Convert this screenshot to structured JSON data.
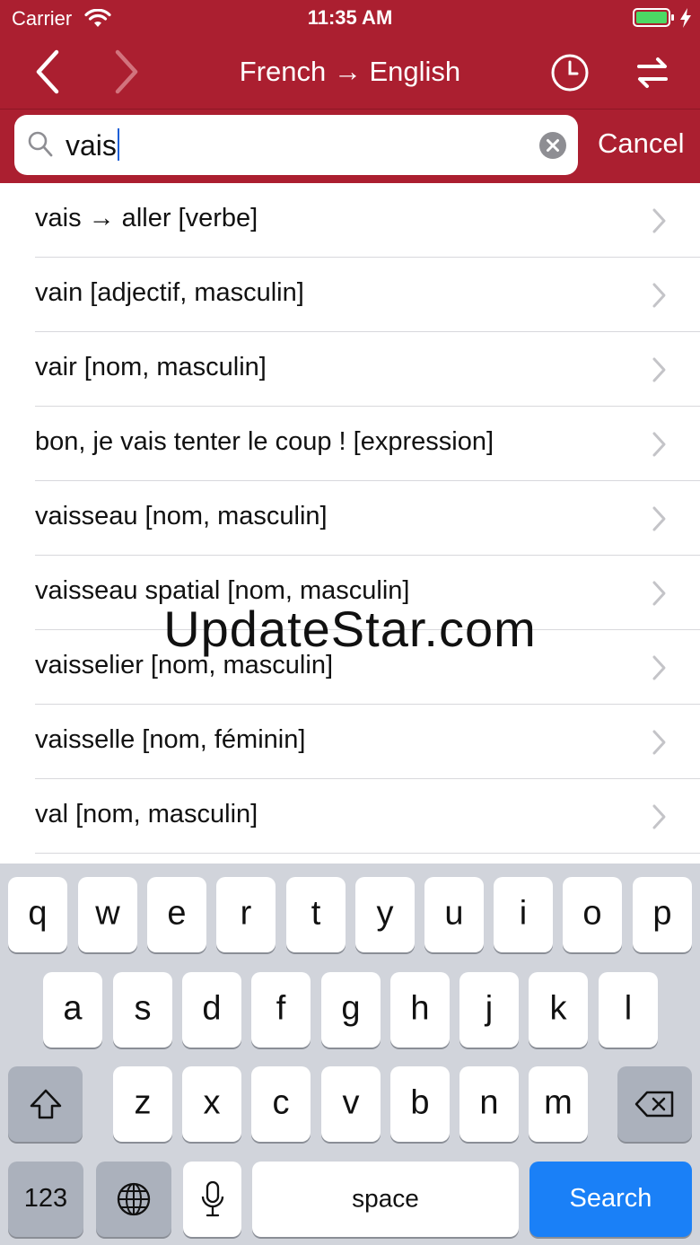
{
  "status_bar": {
    "carrier": "Carrier",
    "time": "11:35 AM"
  },
  "nav": {
    "title": "French → English"
  },
  "search": {
    "query": "vais",
    "cancel_label": "Cancel"
  },
  "results": [
    "vais → aller [verbe]",
    "vain [adjectif, masculin]",
    "vair [nom, masculin]",
    "bon, je vais tenter le coup ! [expression]",
    "vaisseau [nom, masculin]",
    "vaisseau spatial [nom, masculin]",
    "vaisselier [nom, masculin]",
    "vaisselle [nom, féminin]",
    "val [nom, masculin]"
  ],
  "watermark": "UpdateStar.com",
  "keyboard": {
    "row1": [
      "q",
      "w",
      "e",
      "r",
      "t",
      "y",
      "u",
      "i",
      "o",
      "p"
    ],
    "row2": [
      "a",
      "s",
      "d",
      "f",
      "g",
      "h",
      "j",
      "k",
      "l"
    ],
    "row3": [
      "z",
      "x",
      "c",
      "v",
      "b",
      "n",
      "m"
    ],
    "numbers_label": "123",
    "space_label": "space",
    "search_label": "Search"
  },
  "colors": {
    "nav_red": "#ab1f30",
    "key_blue": "#1a80f7",
    "keyboard_bg": "#d1d4db"
  }
}
